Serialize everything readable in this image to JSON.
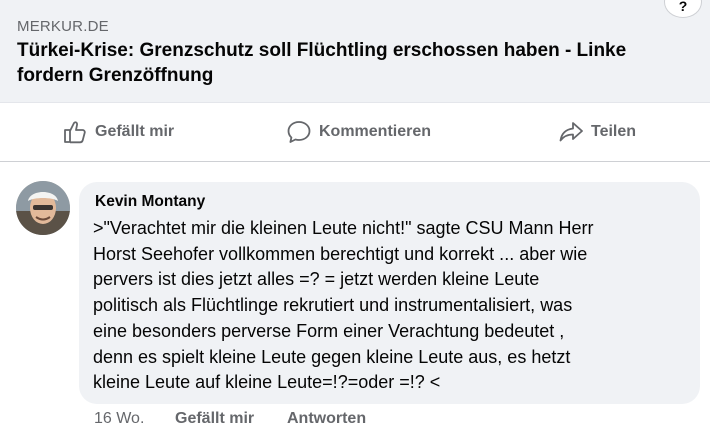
{
  "link_preview": {
    "source": "MERKUR.DE",
    "title": "Türkei-Krise: Grenzschutz soll Flüchtling erschossen haben - Linke fordern Grenzöffnung",
    "corner_badge": "?"
  },
  "actions": {
    "like_label": "Gefällt mir",
    "comment_label": "Kommentieren",
    "share_label": "Teilen"
  },
  "comment": {
    "author": "Kevin Montany",
    "lines": [
      ">\"Verachtet mir die kleinen Leute nicht!\" sagte CSU Mann Herr",
      "Horst Seehofer vollkommen berechtigt und korrekt ... aber wie",
      "pervers ist dies jetzt alles =? = jetzt werden kleine Leute",
      "politisch als Flüchtlinge rekrutiert und instrumentalisiert, was",
      "eine besonders perverse Form einer Verachtung bedeutet ,",
      "denn es spielt kleine Leute gegen kleine Leute aus, es hetzt",
      "kleine Leute auf kleine Leute=!?=oder =!? <"
    ],
    "time": "16 Wo.",
    "like_label": "Gefällt mir",
    "reply_label": "Antworten"
  },
  "colors": {
    "preview_bg": "#f0f2f5",
    "secondary_text": "#65676b",
    "primary_text": "#050505"
  }
}
